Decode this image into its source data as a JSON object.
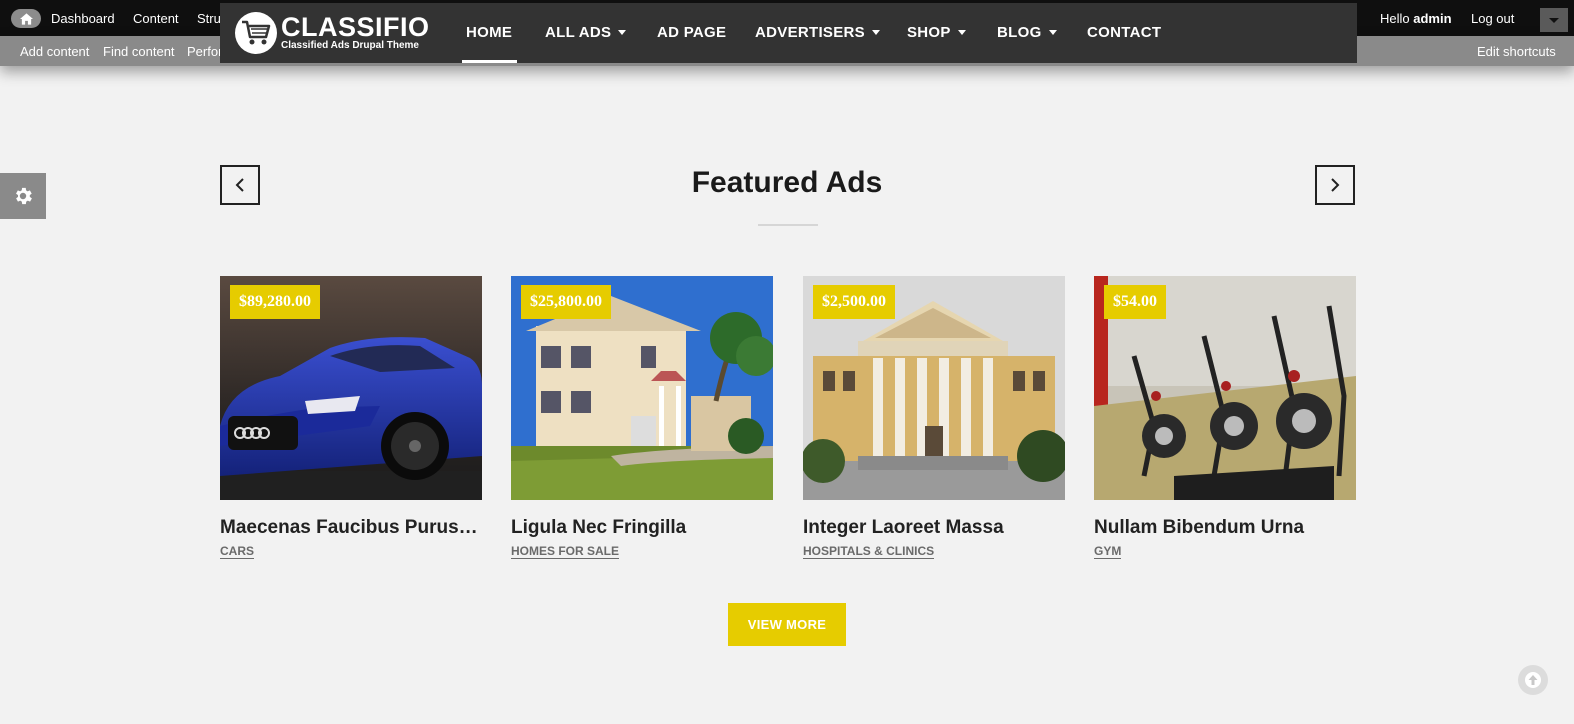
{
  "admin_toolbar": {
    "items": [
      "Dashboard",
      "Content",
      "Stru"
    ],
    "tray": [
      "Add content",
      "Find content",
      "Perfor"
    ],
    "hello_prefix": "Hello",
    "user": "admin",
    "logout": "Log out",
    "edit_shortcuts": "Edit shortcuts"
  },
  "header": {
    "brand": "CLASSIFIO",
    "tagline": "Classified Ads Drupal Theme",
    "nav": [
      {
        "label": "HOME",
        "dropdown": false,
        "active": true
      },
      {
        "label": "ALL ADS",
        "dropdown": true
      },
      {
        "label": "AD PAGE",
        "dropdown": false
      },
      {
        "label": "ADVERTISERS",
        "dropdown": true
      },
      {
        "label": "SHOP",
        "dropdown": true
      },
      {
        "label": "BLOG",
        "dropdown": true
      },
      {
        "label": "CONTACT",
        "dropdown": false
      }
    ]
  },
  "featured": {
    "title": "Featured Ads",
    "view_more": "VIEW MORE",
    "cards": [
      {
        "price": "$89,280.00",
        "title": "Maecenas Faucibus Purus Ve...",
        "category": "CARS"
      },
      {
        "price": "$25,800.00",
        "title": "Ligula Nec Fringilla",
        "category": "HOMES FOR SALE"
      },
      {
        "price": "$2,500.00",
        "title": "Integer Laoreet Massa",
        "category": "HOSPITALS & CLINICS"
      },
      {
        "price": "$54.00",
        "title": "Nullam Bibendum Urna",
        "category": "GYM"
      }
    ]
  },
  "colors": {
    "accent": "#e6cc00",
    "header_bg": "#333333",
    "page_bg": "#f2f2f2"
  }
}
